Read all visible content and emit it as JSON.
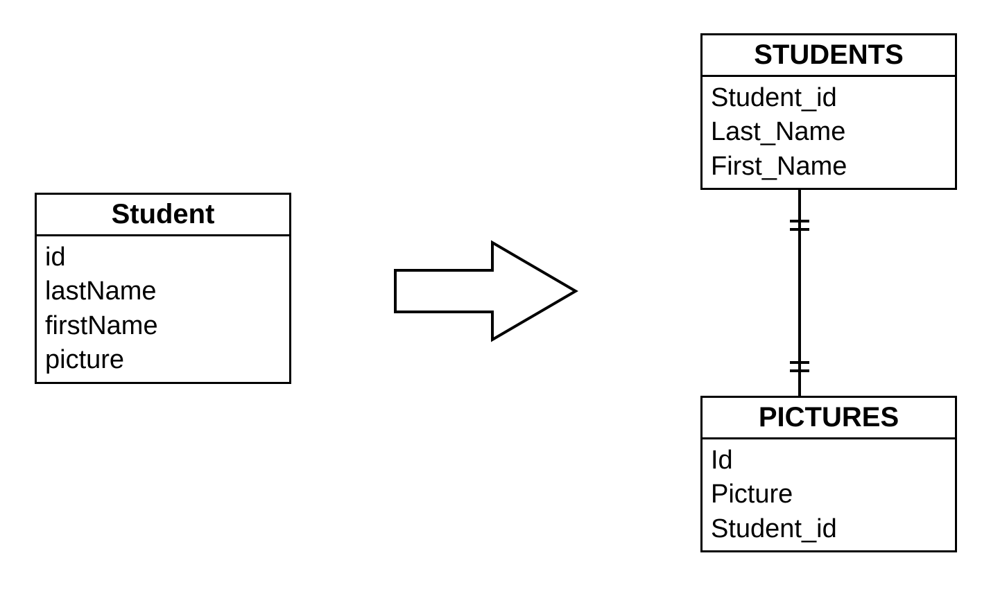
{
  "leftEntity": {
    "title": "Student",
    "fields": [
      "id",
      "lastName",
      "firstName",
      "picture"
    ]
  },
  "topRightEntity": {
    "title": "STUDENTS",
    "fields": [
      "Student_id",
      "Last_Name",
      "First_Name"
    ]
  },
  "bottomRightEntity": {
    "title": "PICTURES",
    "fields": [
      "Id",
      "Picture",
      "Student_id"
    ]
  }
}
